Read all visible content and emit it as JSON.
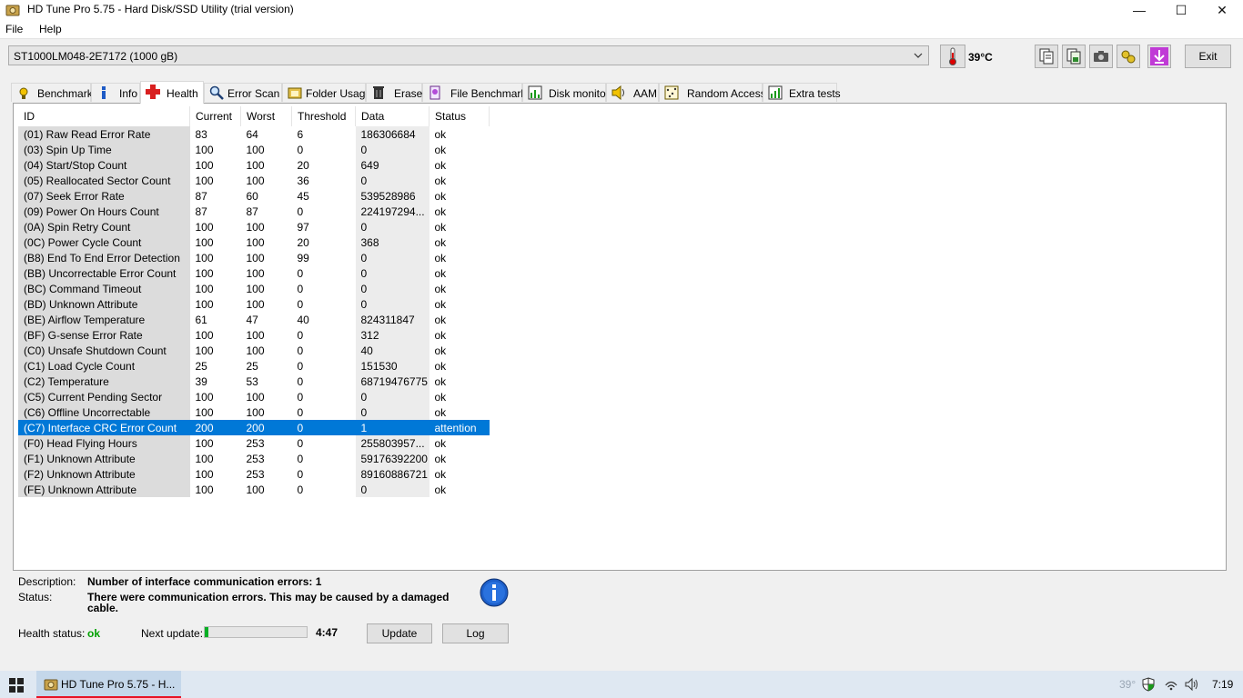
{
  "window": {
    "title": "HD Tune Pro 5.75 - Hard Disk/SSD Utility (trial version)",
    "controls": [
      "—",
      "☐",
      "✕"
    ]
  },
  "menu": {
    "file": "File",
    "help": "Help"
  },
  "toolbar": {
    "drive": "ST1000LM048-2E7172 (1000 gB)",
    "temperature": "39°C",
    "exit_label": "Exit"
  },
  "tabs": [
    {
      "label": "Benchmark",
      "icon": "benchmark-icon"
    },
    {
      "label": "Info",
      "icon": "info-icon"
    },
    {
      "label": "Health",
      "icon": "health-icon"
    },
    {
      "label": "Error Scan",
      "icon": "error-scan-icon"
    },
    {
      "label": "Folder Usage",
      "icon": "folder-icon"
    },
    {
      "label": "Erase",
      "icon": "trash-icon"
    },
    {
      "label": "File Benchmark",
      "icon": "file-benchmark-icon"
    },
    {
      "label": "Disk monitor",
      "icon": "disk-monitor-icon"
    },
    {
      "label": "AAM",
      "icon": "speaker-icon"
    },
    {
      "label": "Random Access",
      "icon": "random-access-icon"
    },
    {
      "label": "Extra tests",
      "icon": "extra-tests-icon"
    }
  ],
  "active_tab": "Health",
  "table": {
    "headers": [
      "ID",
      "Current",
      "Worst",
      "Threshold",
      "Data",
      "Status"
    ],
    "rows": [
      [
        "(01) Raw Read Error Rate",
        "83",
        "64",
        "6",
        "186306684",
        "ok"
      ],
      [
        "(03) Spin Up Time",
        "100",
        "100",
        "0",
        "0",
        "ok"
      ],
      [
        "(04) Start/Stop Count",
        "100",
        "100",
        "20",
        "649",
        "ok"
      ],
      [
        "(05) Reallocated Sector Count",
        "100",
        "100",
        "36",
        "0",
        "ok"
      ],
      [
        "(07) Seek Error Rate",
        "87",
        "60",
        "45",
        "539528986",
        "ok"
      ],
      [
        "(09) Power On Hours Count",
        "87",
        "87",
        "0",
        "224197294...",
        "ok"
      ],
      [
        "(0A) Spin Retry Count",
        "100",
        "100",
        "97",
        "0",
        "ok"
      ],
      [
        "(0C) Power Cycle Count",
        "100",
        "100",
        "20",
        "368",
        "ok"
      ],
      [
        "(B8) End To End Error Detection",
        "100",
        "100",
        "99",
        "0",
        "ok"
      ],
      [
        "(BB) Uncorrectable Error Count",
        "100",
        "100",
        "0",
        "0",
        "ok"
      ],
      [
        "(BC) Command Timeout",
        "100",
        "100",
        "0",
        "0",
        "ok"
      ],
      [
        "(BD) Unknown Attribute",
        "100",
        "100",
        "0",
        "0",
        "ok"
      ],
      [
        "(BE) Airflow Temperature",
        "61",
        "47",
        "40",
        "824311847",
        "ok"
      ],
      [
        "(BF) G-sense Error Rate",
        "100",
        "100",
        "0",
        "312",
        "ok"
      ],
      [
        "(C0) Unsafe Shutdown Count",
        "100",
        "100",
        "0",
        "40",
        "ok"
      ],
      [
        "(C1) Load Cycle Count",
        "25",
        "25",
        "0",
        "151530",
        "ok"
      ],
      [
        "(C2) Temperature",
        "39",
        "53",
        "0",
        "68719476775",
        "ok"
      ],
      [
        "(C5) Current Pending Sector",
        "100",
        "100",
        "0",
        "0",
        "ok"
      ],
      [
        "(C6) Offline Uncorrectable",
        "100",
        "100",
        "0",
        "0",
        "ok"
      ],
      [
        "(C7) Interface CRC Error Count",
        "200",
        "200",
        "0",
        "1",
        "attention"
      ],
      [
        "(F0) Head Flying Hours",
        "100",
        "253",
        "0",
        "255803957...",
        "ok"
      ],
      [
        "(F1) Unknown Attribute",
        "100",
        "253",
        "0",
        "59176392200",
        "ok"
      ],
      [
        "(F2) Unknown Attribute",
        "100",
        "253",
        "0",
        "89160886721",
        "ok"
      ],
      [
        "(FE) Unknown Attribute",
        "100",
        "100",
        "0",
        "0",
        "ok"
      ]
    ],
    "selected_row": 19
  },
  "details": {
    "description_label": "Description:",
    "description": "Number of interface communication errors: 1",
    "status_label": "Status:",
    "status_line1": "There were communication errors. This may be caused by a damaged",
    "status_line2": "cable."
  },
  "footer": {
    "health_label": "Health status:",
    "health_value": "ok",
    "next_update_label": "Next update:",
    "progress": 0.04,
    "countdown": "4:47",
    "update_button": "Update",
    "log_button": "Log"
  },
  "taskbar": {
    "app_label": "HD Tune Pro 5.75 - H...",
    "tray_temp": "39°",
    "clock": "7:19"
  },
  "colors": {
    "selection": "#0078d7",
    "ok_green": "#00a000",
    "progress_green": "#06b025"
  }
}
